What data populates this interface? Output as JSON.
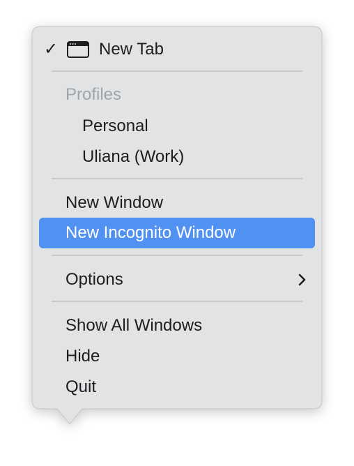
{
  "menu": {
    "new_tab": {
      "checkmark": "✓",
      "icon": "browser-tab-icon",
      "label": "New Tab"
    },
    "profiles": {
      "title": "Profiles",
      "items": [
        {
          "label": "Personal"
        },
        {
          "label": "Uliana (Work)"
        }
      ]
    },
    "window_items": [
      {
        "label": "New Window",
        "highlighted": false
      },
      {
        "label": "New Incognito Window",
        "highlighted": true
      }
    ],
    "options": {
      "label": "Options",
      "icon": "chevron-right-icon"
    },
    "app_items": [
      {
        "label": "Show All Windows"
      },
      {
        "label": "Hide"
      },
      {
        "label": "Quit"
      }
    ]
  },
  "colors": {
    "menu_background": "#e1e3e4",
    "highlight": "#5191f1",
    "separator": "#c7c9ca",
    "disabled_text": "#a2a5a7",
    "text": "#1d1d1f"
  }
}
